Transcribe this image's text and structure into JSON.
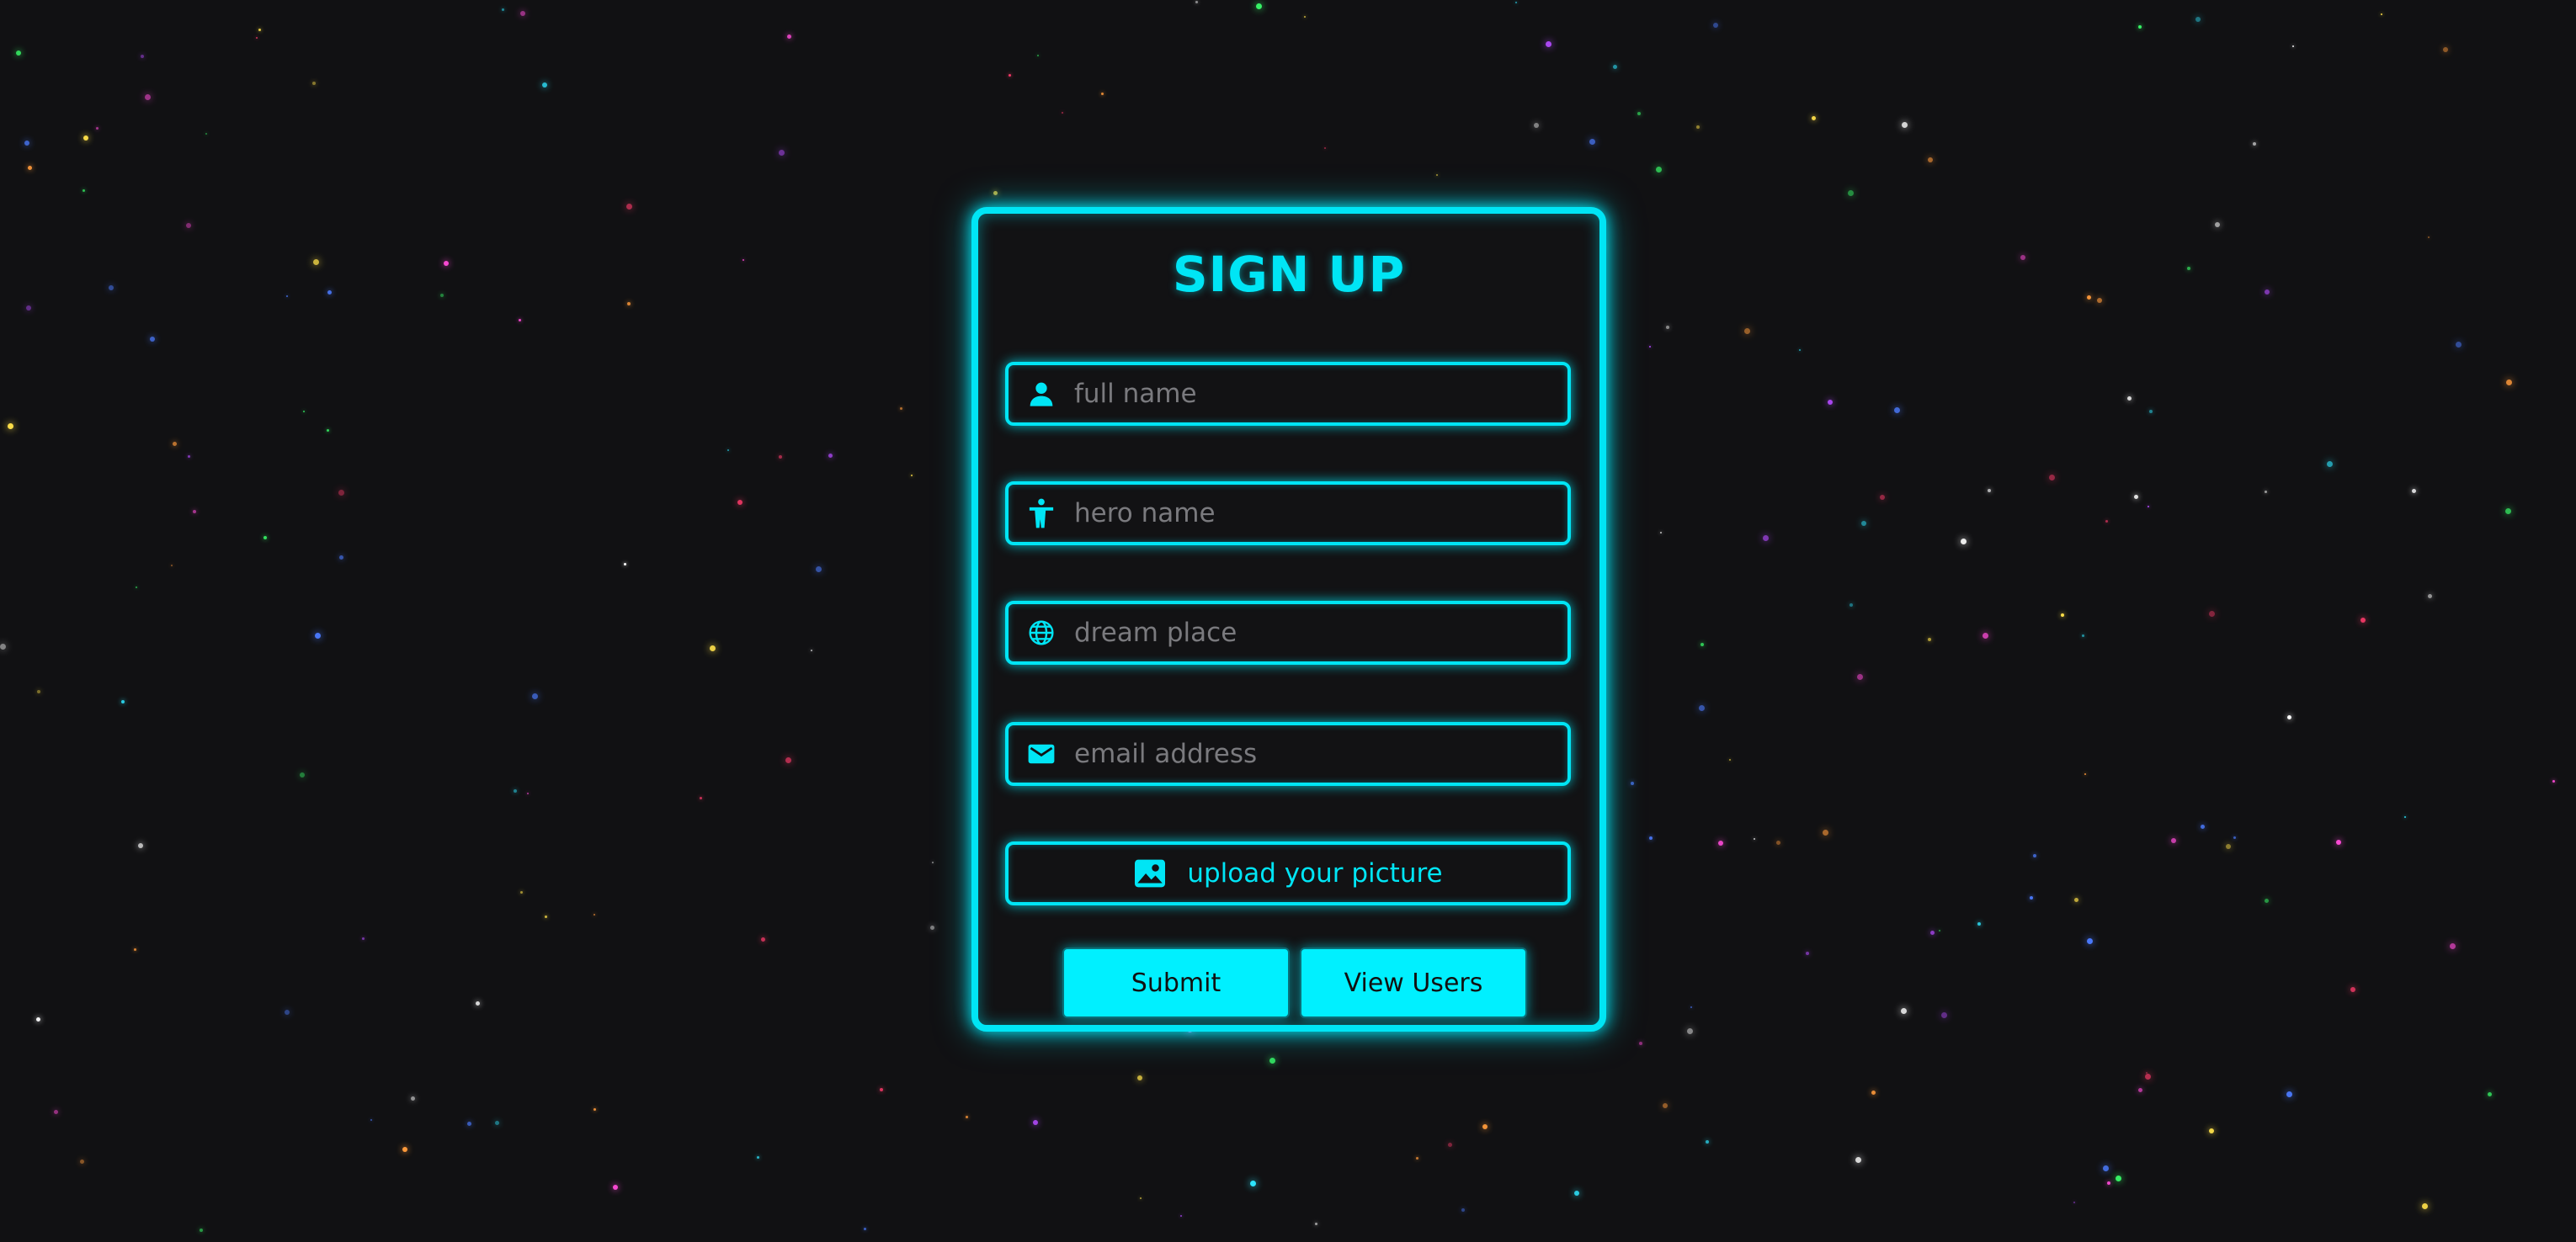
{
  "form": {
    "title": "SIGN UP",
    "fields": [
      {
        "placeholder": "full name",
        "value": "",
        "icon": "user-icon"
      },
      {
        "placeholder": "hero name",
        "value": "",
        "icon": "hero-icon"
      },
      {
        "placeholder": "dream place",
        "value": "",
        "icon": "globe-icon"
      },
      {
        "placeholder": "email address",
        "value": "",
        "icon": "mail-icon"
      }
    ],
    "upload_label": "upload your picture",
    "upload_icon": "image-icon",
    "submit_label": "Submit",
    "view_users_label": "View Users"
  },
  "colors": {
    "accent": "#00e5f5",
    "background": "#111113",
    "button": "#00f0ff"
  }
}
